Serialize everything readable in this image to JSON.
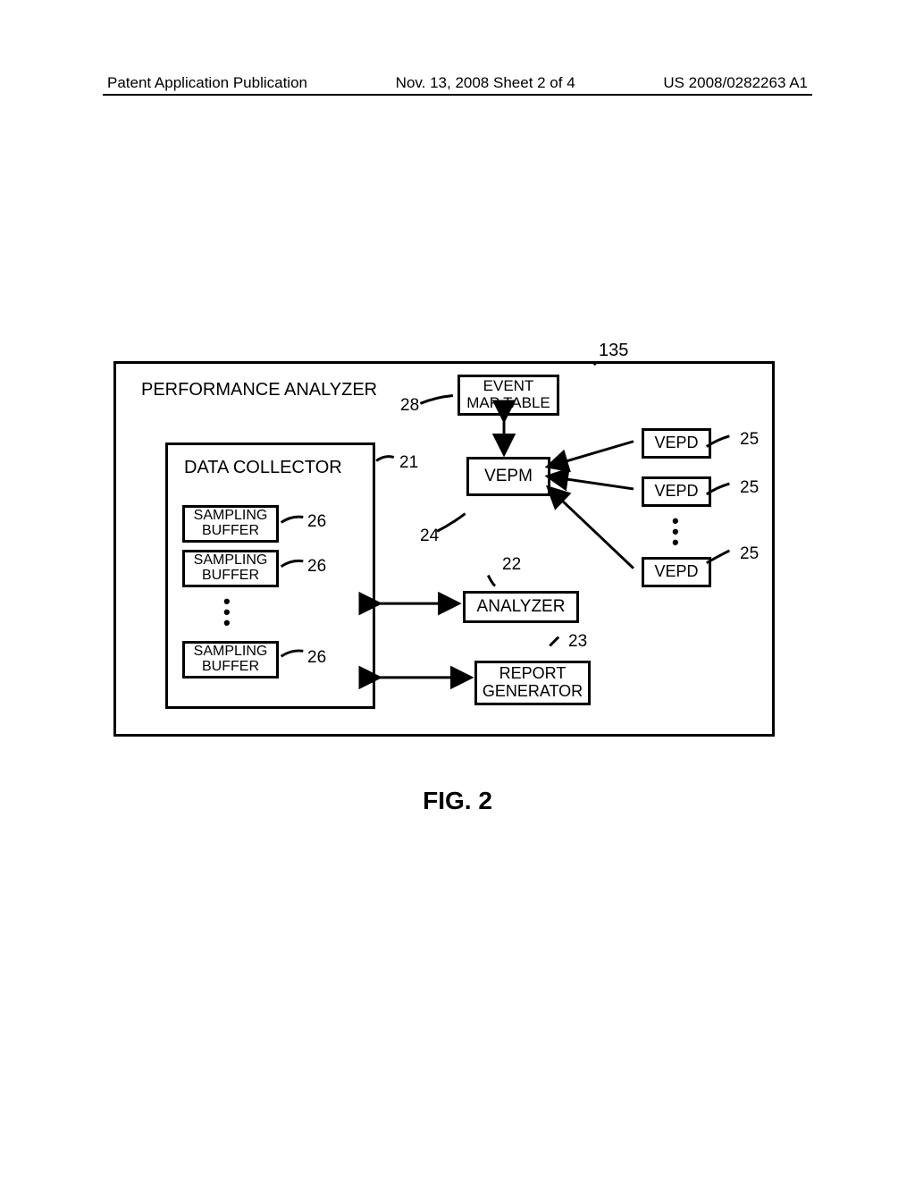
{
  "header": {
    "left": "Patent Application Publication",
    "center": "Nov. 13, 2008  Sheet 2 of 4",
    "right": "US 2008/0282263 A1"
  },
  "diagram": {
    "outer_title": "PERFORMANCE ANALYZER",
    "outer_ref": "135",
    "event_map_table": {
      "label": "EVENT\nMAP TABLE",
      "ref": "28"
    },
    "data_collector": {
      "title": "DATA COLLECTOR",
      "ref": "21"
    },
    "sampling_buffers": [
      {
        "label": "SAMPLING\nBUFFER",
        "ref": "26"
      },
      {
        "label": "SAMPLING\nBUFFER",
        "ref": "26"
      },
      {
        "label": "SAMPLING\nBUFFER",
        "ref": "26"
      }
    ],
    "vepm": {
      "label": "VEPM",
      "ref": "24"
    },
    "analyzer": {
      "label": "ANALYZER",
      "ref": "22"
    },
    "report_generator": {
      "label": "REPORT\nGENERATOR",
      "ref": "23"
    },
    "vepds": [
      {
        "label": "VEPD",
        "ref": "25"
      },
      {
        "label": "VEPD",
        "ref": "25"
      },
      {
        "label": "VEPD",
        "ref": "25"
      }
    ]
  },
  "figure_caption": "FIG. 2"
}
